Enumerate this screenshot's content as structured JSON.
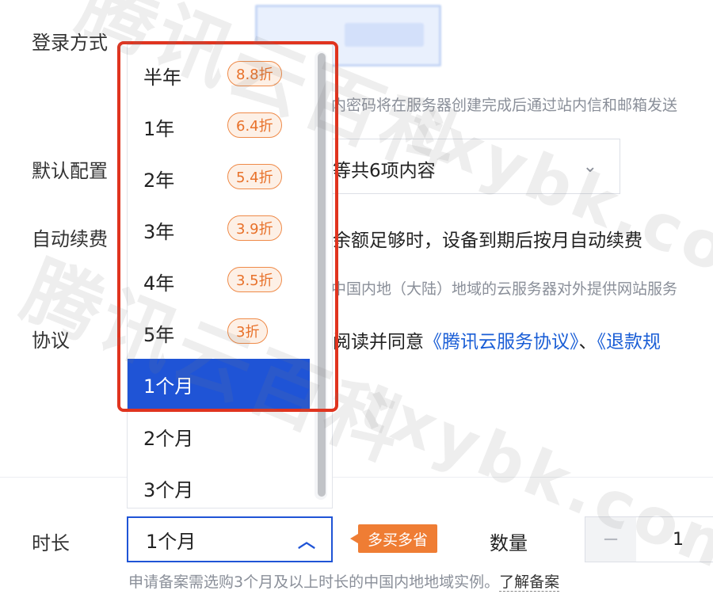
{
  "form": {
    "login_label": "登录方式",
    "login_desc": "内密码将在服务器创建完成后通过站内信和邮箱发送",
    "config_label": "默认配置",
    "config_value": "等共6项内容",
    "renew_label": "自动续费",
    "renew_text": "余额足够时，设备到期后按月自动续费",
    "region_desc": "中国内地（大陆）地域的云服务器对外提供网站服务",
    "agreement_label": "协议",
    "agreement_prefix": "阅读并同意",
    "agreement_link1": "《腾讯云服务协议》",
    "agreement_sep": "、",
    "agreement_link2": "《退款规"
  },
  "dropdown": {
    "options": [
      {
        "label": "半年",
        "badge": "8.8折"
      },
      {
        "label": "1年",
        "badge": "6.4折"
      },
      {
        "label": "2年",
        "badge": "5.4折"
      },
      {
        "label": "3年",
        "badge": "3.9折"
      },
      {
        "label": "4年",
        "badge": "3.5折"
      },
      {
        "label": "5年",
        "badge": "3折"
      },
      {
        "label": "1个月",
        "badge": ""
      },
      {
        "label": "2个月",
        "badge": ""
      },
      {
        "label": "3个月",
        "badge": ""
      }
    ],
    "selected_index": 6
  },
  "duration": {
    "label": "时长",
    "value": "1个月",
    "promo": "多买多省",
    "note": "申请备案需选购3个月及以上时长的中国内地地域实例。",
    "note_link": "了解备案"
  },
  "quantity": {
    "label": "数量",
    "minus": "−",
    "value": "1"
  },
  "watermark": {
    "text1": "腾讯云百科",
    "text2": "txybk.com",
    "text3": "腾讯云百科",
    "text4": "txybk.com"
  },
  "colors": {
    "primary": "#1f54d6",
    "highlight": "#e0341f",
    "promo": "#ef7d34",
    "link": "#1a5ed6"
  }
}
